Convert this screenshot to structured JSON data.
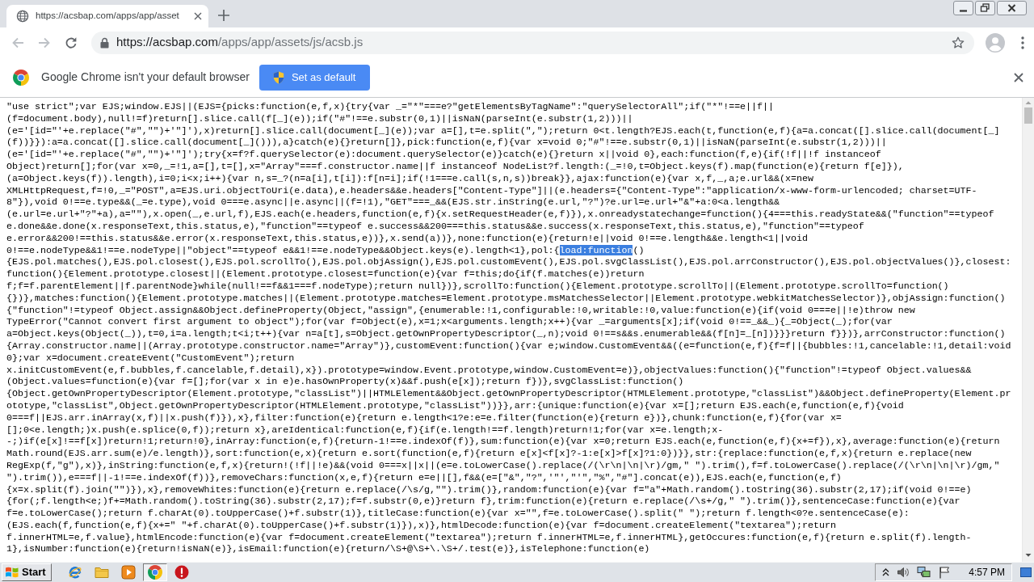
{
  "browser": {
    "tabs": [
      {
        "title": "https://acsbap.com/apps/app/asset",
        "selected": true
      }
    ],
    "address": {
      "url_origin": "https://acsbap.com",
      "url_path": "/apps/app/assets/js/acsb.js"
    }
  },
  "infobar": {
    "message": "Google Chrome isn't your default browser",
    "button": "Set as default"
  },
  "source": {
    "lines": [
      "\"use strict\";var EJS;window.EJS||(EJS={picks:function(e,f,x){try{var _=\"*\"===e?\"getElementsByTagName\":\"querySelectorAll\";if(\"*\"!==e||f||",
      "(f=document.body),null!=f)return[].slice.call(f[_](e));if(\"#\"!==e.substr(0,1)||isNaN(parseInt(e.substr(1,2)))||",
      "(e='[id=\"'+e.replace(\"#\",\"\")+'\"]'),x)return[].slice.call(document[_](e));var a=[],t=e.split(\",\");return 0<t.length?EJS.each(t,function(e,f){a=a.concat([].slice.call(document[_]",
      "(f))}}):a=a.concat([].slice.call(document[_]())),a}catch(e){}return[]},pick:function(e,f){var x=void 0;\"#\"!==e.substr(0,1)||isNaN(parseInt(e.substr(1,2)))||",
      "(e='[id=\"'+e.replace(\"#\",\"\")+'\"]');try{x=f?f.querySelector(e):document.querySelector(e)}catch(e){}return x||void 0},each:function(f,e){if(!f||!f instanceof",
      "Object)return[];for(var x=0,_=!1,a=[],t=[],x=\"Array\"===f.constructor.name||f instanceof NodeList?f.length:(_=!0,t=Object.keys(f).map(function(e){return f[e]}),",
      "(a=Object.keys(f)).length),i=0;i<x;i++){var n,s=_?(n=a[i],t[i]):f[n=i];if(!1===e.call(s,n,s))break}},ajax:function(e){var x,f,_,a;e.url&&(x=new",
      "XMLHttpRequest,f=!0,_=\"POST\",a=EJS.uri.objectToUri(e.data),e.headers&&e.headers[\"Content-Type\"]||(e.headers={\"Content-Type\":\"application/x-www-form-urlencoded; charset=UTF-",
      "8\"}),void 0!==e.type&&(_=e.type),void 0===e.async||e.async||(f=!1),\"GET\"===_&&(EJS.str.inString(e.url,\"?\")?e.url=e.url+\"&\"+a:0<a.length&&",
      "(e.url=e.url+\"?\"+a),a=\"\"),x.open(_,e.url,f),EJS.each(e.headers,function(e,f){x.setRequestHeader(e,f)}),x.onreadystatechange=function(){4===this.readyState&&(\"function\"==typeof",
      "e.done&&e.done(x.responseText,this.status,e),\"function\"==typeof e.success&&200===this.status&&e.success(x.responseText,this.status,e),\"function\"==typeof",
      "e.error&&200!==this.status&&e.error(x.responseText,this.status,e))},x.send(a))},none:function(e){return!e||void 0!==e.length&&e.length<1||void",
      {
        "segments": [
          {
            "text": "0!==e.nodeType&&1!==e.nodeType||\"object\"==typeof e&&1!==e.nodeType&&Object.keys(e).length<1},pol:{",
            "selected": false
          },
          {
            "text": "load:function",
            "selected": true
          },
          {
            "text": "()",
            "selected": false
          }
        ]
      },
      "{EJS.pol.matches(),EJS.pol.closest(),EJS.pol.scrollTo(),EJS.pol.objAssign(),EJS.pol.customEvent(),EJS.pol.svgClassList(),EJS.pol.arrConstructor(),EJS.pol.objectValues()},closest:",
      "function(){Element.prototype.closest||(Element.prototype.closest=function(e){var f=this;do{if(f.matches(e))return",
      "f;f=f.parentElement||f.parentNode}while(null!==f&&1===f.nodeType);return null})},scrollTo:function(){Element.prototype.scrollTo||(Element.prototype.scrollTo=function()",
      "{})},matches:function(){Element.prototype.matches||(Element.prototype.matches=Element.prototype.msMatchesSelector||Element.prototype.webkitMatchesSelector)},objAssign:function()",
      "{\"function\"!=typeof Object.assign&&Object.defineProperty(Object,\"assign\",{enumerable:!1,configurable:!0,writable:!0,value:function(e){if(void 0===e||!e)throw new",
      "TypeError(\"Cannot convert first argument to object\");for(var f=Object(e),x=1;x<arguments.length;x++){var _=arguments[x];if(void 0!==_&&_){_=Object(_);for(var",
      "a=Object.keys(Object(_)),t=0,i=a.length;t<i;t++){var n=a[t],s=Object.getOwnPropertyDescriptor(_,n);void 0!==s&&s.enumerable&&(f[n]=_[n])}}}return f}})},arrConstructor:function()",
      "{Array.constructor.name||(Array.prototype.constructor.name=\"Array\")},customEvent:function(){var e;window.CustomEvent&&((e=function(e,f){f=f||{bubbles:!1,cancelable:!1,detail:void",
      "0};var x=document.createEvent(\"CustomEvent\");return",
      "x.initCustomEvent(e,f.bubbles,f.cancelable,f.detail),x}).prototype=window.Event.prototype,window.CustomEvent=e)},objectValues:function(){\"function\"!=typeof Object.values&&",
      "(Object.values=function(e){var f=[];for(var x in e)e.hasOwnProperty(x)&&f.push(e[x]);return f})},svgClassList:function()",
      "{Object.getOwnPropertyDescriptor(Element.prototype,\"classList\")||HTMLElement&&Object.getOwnPropertyDescriptor(HTMLElement.prototype,\"classList\")&&Object.defineProperty(Element.pr",
      "ototype,\"classList\",Object.getOwnPropertyDescriptor(HTMLElement.prototype,\"classList\"))}},arr:{unique:function(e){var x=[];return EJS.each(e,function(e,f){void",
      "0===f||EJS.arr.inArray(x,f)||x.push(f)}),x},filter:function(e){return e.length<1?e:e=e.filter(function(e){return e})},chunk:function(e,f){for(var x=",
      "[];0<e.length;)x.push(e.splice(0,f));return x},areIdentical:function(e,f){if(e.length!==f.length)return!1;for(var x=e.length;x-",
      "-;)if(e[x]!==f[x])return!1;return!0},inArray:function(e,f){return-1!==e.indexOf(f)},sum:function(e){var x=0;return EJS.each(e,function(e,f){x+=f}),x},average:function(e){return",
      "Math.round(EJS.arr.sum(e)/e.length)},sort:function(e,x){return e.sort(function(e,f){return e[x]<f[x]?-1:e[x]>f[x]?1:0})}},str:{replace:function(e,f,x){return e.replace(new",
      "RegExp(f,\"g\"),x)},inString:function(e,f,x){return!(!f||!e)&&(void 0===x||x||(e=e.toLowerCase().replace(/(\\r\\n|\\n|\\r)/gm,\" \").trim(),f=f.toLowerCase().replace(/(\\r\\n|\\n|\\r)/gm,\"",
      "\").trim()),e===f||-1!==e.indexOf(f))},removeChars:function(x,e,f){return e=e||[],f&&(e=[\"&\",\"?\",'\"',\"'\",\"%\",\"#\"].concat(e)),EJS.each(e,function(e,f)",
      "{x=x.split(f).join(\"\")}),x},removeWhites:function(e){return e.replace(/\\s/g,\"\").trim()},random:function(e){var f=\"a\"+Math.random().toString(36).substr(2,17);if(void 0!==e)",
      "{for(;f.length<e;)f+=Math.random().toString(36).substr(2,17);f=f.substr(0,e)}return f},trim:function(e){return e.replace(/\\s+/g,\" \").trim()},sentenceCase:function(e){var",
      "f=e.toLowerCase();return f.charAt(0).toUpperCase()+f.substr(1)},titleCase:function(e){var x=\"\",f=e.toLowerCase().split(\" \");return f.length<0?e.sentenceCase(e):",
      "(EJS.each(f,function(e,f){x+=\" \"+f.charAt(0).toUpperCase()+f.substr(1)}),x)},htmlDecode:function(e){var f=document.createElement(\"textarea\");return",
      "f.innerHTML=e,f.value},htmlEncode:function(e){var f=document.createElement(\"textarea\");return f.innerHTML=e,f.innerHTML},getOccures:function(e,f){return e.split(f).length-",
      "1},isNumber:function(e){return!isNaN(e)},isEmail:function(e){return/\\S+@\\S+\\.\\S+/.test(e)},isTelephone:function(e)"
    ]
  },
  "taskbar": {
    "start": "Start",
    "apps": [
      {
        "kind": "globe-e",
        "selected": false
      },
      {
        "kind": "folder",
        "selected": false
      },
      {
        "kind": "player",
        "selected": false
      },
      {
        "kind": "round",
        "selected": true
      },
      {
        "kind": "alert",
        "selected": false
      }
    ],
    "clock": "4:57 PM"
  }
}
